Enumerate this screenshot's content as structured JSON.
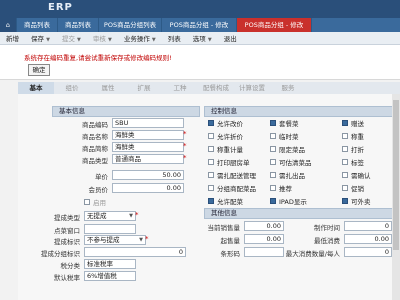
{
  "app": {
    "brand": "ERP"
  },
  "tabs": [
    "",
    "商品列表",
    "商品列表",
    "POS商品分组列表",
    "POS商品分组 - 修改",
    "POS商品分组 - 修改"
  ],
  "menubar": [
    "新增",
    "保存",
    "提交",
    "审核",
    "业务操作",
    "列表",
    "选项",
    "退出"
  ],
  "alert": {
    "message": "系统存在编码重复,请尝试重新保存或修改编码规则!",
    "ok_label": "确定"
  },
  "content_tabs": [
    "基本",
    "组价",
    "属性",
    "扩展",
    "工种",
    "配餐构成",
    "计算设置",
    "服务"
  ],
  "basic": {
    "title": "基本信息",
    "fields": [
      {
        "label": "商品编码",
        "value": "SBU",
        "required": false
      },
      {
        "label": "商品名称",
        "value": "海鲜类",
        "required": true
      },
      {
        "label": "商品简称",
        "value": "海鲜类",
        "required": true
      },
      {
        "label": "商品类型",
        "value": "普通商品",
        "required": true
      },
      {
        "label": "单价",
        "value": "50.00",
        "required": false
      },
      {
        "label": "会员价",
        "value": "0.00",
        "required": false
      }
    ],
    "enable_label": "启用",
    "fields2": [
      {
        "label": "提成类型",
        "value": "无提成",
        "required": true
      },
      {
        "label": "点菜窗口",
        "value": "",
        "required": false
      },
      {
        "label": "提成标识",
        "value": "不参与提成",
        "required": true
      },
      {
        "label": "提成分组标识",
        "value": "0",
        "required": false
      },
      {
        "label": "税分类",
        "value": "标准税率",
        "required": false
      },
      {
        "label": "默认税率",
        "value": "6%增值税",
        "required": false
      }
    ]
  },
  "control": {
    "title": "控制信息",
    "col1": [
      {
        "label": "允许改价",
        "checked": true
      },
      {
        "label": "允许折价",
        "checked": false
      },
      {
        "label": "称重计量",
        "checked": false
      },
      {
        "label": "打印厨房单",
        "checked": false
      },
      {
        "label": "需扎配送管理",
        "checked": false
      },
      {
        "label": "分组商配菜品",
        "checked": false
      },
      {
        "label": "允许配菜",
        "checked": true
      }
    ],
    "col2": [
      {
        "label": "套餐菜",
        "checked": true
      },
      {
        "label": "临时菜",
        "checked": false
      },
      {
        "label": "限定菜品",
        "checked": false
      },
      {
        "label": "可估清菜品",
        "checked": false
      },
      {
        "label": "需扎出品",
        "checked": false
      },
      {
        "label": "推荐",
        "checked": false
      },
      {
        "label": "IPAD显示",
        "checked": true
      }
    ],
    "col3": [
      {
        "label": "赠送",
        "checked": true
      },
      {
        "label": "称重",
        "checked": false
      },
      {
        "label": "打折",
        "checked": false
      },
      {
        "label": "标签",
        "checked": false
      },
      {
        "label": "需确认",
        "checked": false
      },
      {
        "label": "促销",
        "checked": false
      },
      {
        "label": "可外卖",
        "checked": true
      }
    ]
  },
  "other": {
    "title": "其他信息",
    "left": [
      {
        "label": "当前销售量",
        "value": "0.00"
      },
      {
        "label": "起售量",
        "value": "0.00"
      },
      {
        "label": "条形码",
        "value": ""
      }
    ],
    "right": [
      {
        "label": "制作时间",
        "value": "0"
      },
      {
        "label": "最低消费",
        "value": "0.00"
      },
      {
        "label": "最大消费数量/每人",
        "value": "0"
      }
    ]
  }
}
